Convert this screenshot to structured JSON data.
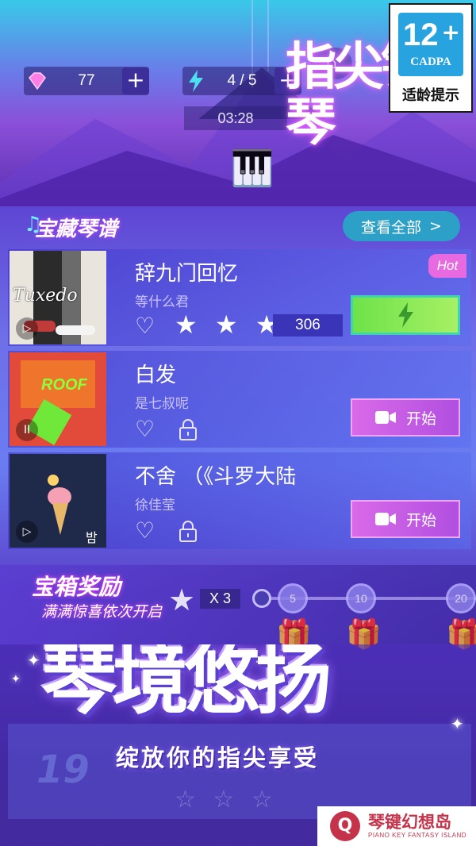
{
  "age_rating": {
    "number": "12",
    "plus": "+",
    "org": "CADPA",
    "caption": "适龄提示"
  },
  "status": {
    "gems": "77",
    "energy": "4 / 5",
    "timer": "03:28"
  },
  "logo_text": "指尖钢琴",
  "section": {
    "title": "宝藏琴谱",
    "view_all": "查看全部",
    "view_all_arrow": ">"
  },
  "songs": [
    {
      "title": "辞九门回忆",
      "artist": "等什么君",
      "badge": "Hot",
      "score": "306",
      "stars": "★ ★ ★",
      "cover_text": "Tuxedo",
      "cover_control": "▷"
    },
    {
      "title": "白发",
      "artist": "是七叔呢",
      "action": "开始",
      "cover_text": "ROOF",
      "cover_control": "II"
    },
    {
      "title": "不舍 （《斗罗大陆",
      "artist": "徐佳莹",
      "action": "开始",
      "cover_text": "밤",
      "cover_control": "▷"
    }
  ],
  "reward": {
    "title": "宝箱奖励",
    "subtitle": "满满惊喜依次开启",
    "multiplier": "X 3",
    "milestones": [
      "5",
      "10",
      "20"
    ]
  },
  "promo": {
    "headline": "琴境悠扬",
    "tagline": "绽放你的指尖享受",
    "ghost_num": "19"
  },
  "brand": {
    "glyph": "Q",
    "name": "琴键幻想岛",
    "english": "PIANO KEY FANTASY ISLAND"
  },
  "colors": {
    "accent_cyan": "#2ca0c6",
    "start_purple": "#d96ae8",
    "green_action": "#6ee24a",
    "hot_pink": "#e86ae0"
  },
  "icons": [
    "diamond-icon",
    "lightning-icon",
    "plus-icon",
    "home-icon",
    "heart-icon",
    "lock-icon",
    "star-icon",
    "video-icon",
    "gift-icon"
  ]
}
